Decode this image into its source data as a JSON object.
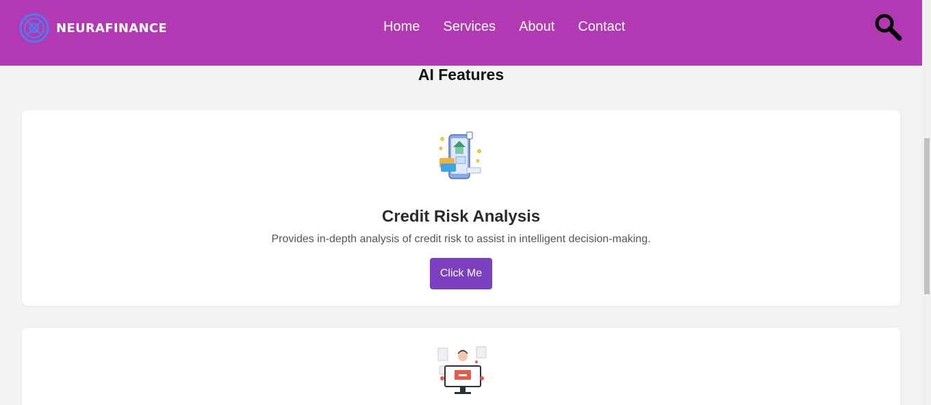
{
  "brand": {
    "name": "NEURAFINANCE",
    "logo_icon": "neural-ring-logo",
    "color": "#b338b3"
  },
  "nav": {
    "items": [
      "Home",
      "Services",
      "About",
      "Contact"
    ]
  },
  "header": {
    "search_icon": "search-icon"
  },
  "section": {
    "title": "AI Features"
  },
  "cards": [
    {
      "title": "Credit Risk Analysis",
      "description": "Provides in-depth analysis of credit risk to assist in intelligent decision-making.",
      "button_label": "Click Me",
      "illustration": "mobile-banking-illustration"
    },
    {
      "illustration": "analyst-dashboard-illustration"
    }
  ],
  "colors": {
    "header_bg": "#b338b3",
    "button_bg": "#7b3fbf",
    "page_bg": "#f3f3f3"
  }
}
